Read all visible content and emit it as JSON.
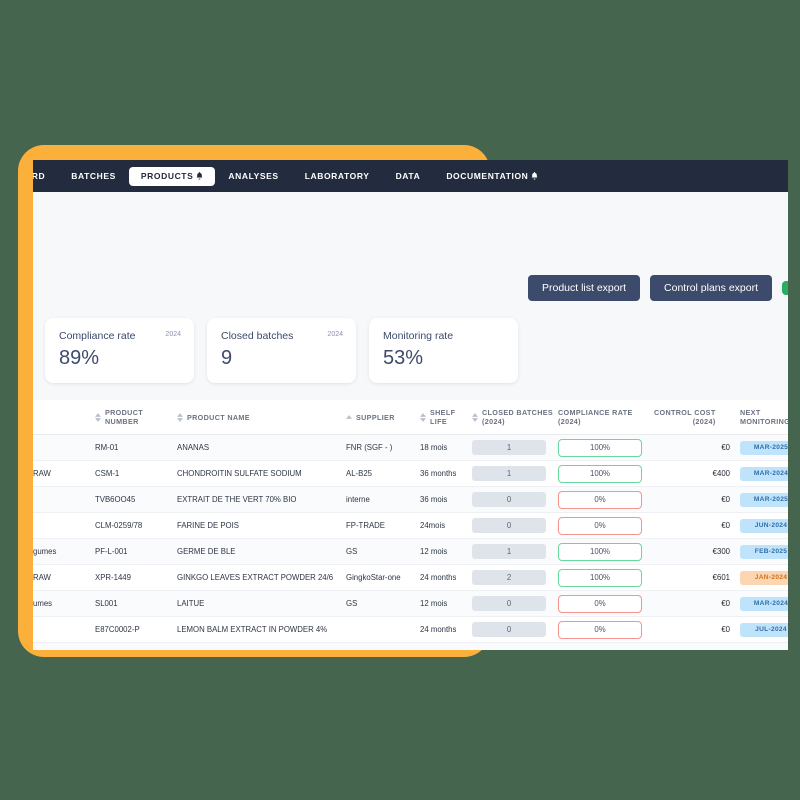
{
  "nav": {
    "items": [
      {
        "label": "ARD",
        "active": false,
        "bell": false
      },
      {
        "label": "BATCHES",
        "active": false,
        "bell": false
      },
      {
        "label": "PRODUCTS",
        "active": true,
        "bell": true
      },
      {
        "label": "ANALYSES",
        "active": false,
        "bell": false
      },
      {
        "label": "LABORATORY",
        "active": false,
        "bell": false
      },
      {
        "label": "DATA",
        "active": false,
        "bell": false
      },
      {
        "label": "DOCUMENTATION",
        "active": false,
        "bell": true
      }
    ]
  },
  "toolbar": {
    "product_list_export": "Product list export",
    "control_plans_export": "Control plans export"
  },
  "cards": [
    {
      "title": "Compliance rate",
      "year": "2024",
      "value": "89%"
    },
    {
      "title": "Closed batches",
      "year": "2024",
      "value": "9"
    },
    {
      "title": "Monitoring rate",
      "year": "",
      "value": "53%"
    }
  ],
  "table": {
    "headers": [
      {
        "label": "",
        "sort": "none"
      },
      {
        "label": "PRODUCT NUMBER",
        "sort": "both"
      },
      {
        "label": "PRODUCT NAME",
        "sort": "both"
      },
      {
        "label": "SUPPLIER",
        "sort": "asc"
      },
      {
        "label": "SHELF LIFE",
        "sort": "both"
      },
      {
        "label": "CLOSED BATCHES (2024)",
        "sort": "both"
      },
      {
        "label": "COMPLIANCE RATE (2024)",
        "sort": "none"
      },
      {
        "label": "CONTROL COST (2024)",
        "sort": "none"
      },
      {
        "label": "NEXT MONITORING",
        "sort": "none"
      }
    ],
    "rows": [
      {
        "category": "",
        "number": "RM-01",
        "name": "ANANAS",
        "supplier": "FNR (SGF - )",
        "shelf_life": "18 mois",
        "closed_batches": "1",
        "compliance": "100%",
        "compliance_state": "ok",
        "cost": "€0",
        "next": "MAR-2025",
        "next_state": "blue"
      },
      {
        "category": "RAW",
        "number": "CSM-1",
        "name": "CHONDROITIN SULFATE SODIUM",
        "supplier": "AL-B25",
        "shelf_life": "36 months",
        "closed_batches": "1",
        "compliance": "100%",
        "compliance_state": "ok",
        "cost": "€400",
        "next": "MAR-2024",
        "next_state": "blue"
      },
      {
        "category": "",
        "number": "TVB6OO45",
        "name": "EXTRAIT DE THE VERT 70% BIO",
        "supplier": "interne",
        "shelf_life": "36 mois",
        "closed_batches": "0",
        "compliance": "0%",
        "compliance_state": "bad",
        "cost": "€0",
        "next": "MAR-2025",
        "next_state": "blue"
      },
      {
        "category": "",
        "number": "CLM-0259/78",
        "name": "FARINE DE POIS",
        "supplier": "FP-TRADE",
        "shelf_life": "24mois",
        "closed_batches": "0",
        "compliance": "0%",
        "compliance_state": "bad",
        "cost": "€0",
        "next": "JUN-2024",
        "next_state": "blue"
      },
      {
        "category": "gumes",
        "number": "PF-L-001",
        "name": "GERME DE BLE",
        "supplier": "GS",
        "shelf_life": "12 mois",
        "closed_batches": "1",
        "compliance": "100%",
        "compliance_state": "ok",
        "cost": "€300",
        "next": "FEB-2025",
        "next_state": "blue"
      },
      {
        "category": "RAW",
        "number": "XPR-1449",
        "name": "GINKGO LEAVES EXTRACT POWDER 24/6",
        "supplier": "GingkoStar-one",
        "shelf_life": "24 months",
        "closed_batches": "2",
        "compliance": "100%",
        "compliance_state": "ok",
        "cost": "€601",
        "next": "JAN-2024",
        "next_state": "orange"
      },
      {
        "category": "umes",
        "number": "SL001",
        "name": "LAITUE",
        "supplier": "GS",
        "shelf_life": "12 mois",
        "closed_batches": "0",
        "compliance": "0%",
        "compliance_state": "bad",
        "cost": "€0",
        "next": "MAR-2024",
        "next_state": "blue"
      },
      {
        "category": "",
        "number": "E87C0002-P",
        "name": "LEMON BALM EXTRACT IN POWDER 4%",
        "supplier": "",
        "shelf_life": "24 months",
        "closed_batches": "0",
        "compliance": "0%",
        "compliance_state": "bad",
        "cost": "€0",
        "next": "JUL-2024",
        "next_state": "blue"
      },
      {
        "category": "",
        "number": "",
        "name": "",
        "supplier": "",
        "shelf_life": "",
        "closed_batches": "",
        "compliance": "",
        "compliance_state": "bad",
        "cost": "",
        "next": "",
        "next_state": "orange"
      }
    ]
  },
  "colors": {
    "background": "#46654f",
    "accent_frame": "#fbb03b",
    "navbar": "#232b3e",
    "button": "#3c4a6b",
    "ok": "#68d79b",
    "bad": "#f4948c",
    "chip_blue": "#bfe3fb",
    "chip_orange": "#fbd6b0"
  }
}
